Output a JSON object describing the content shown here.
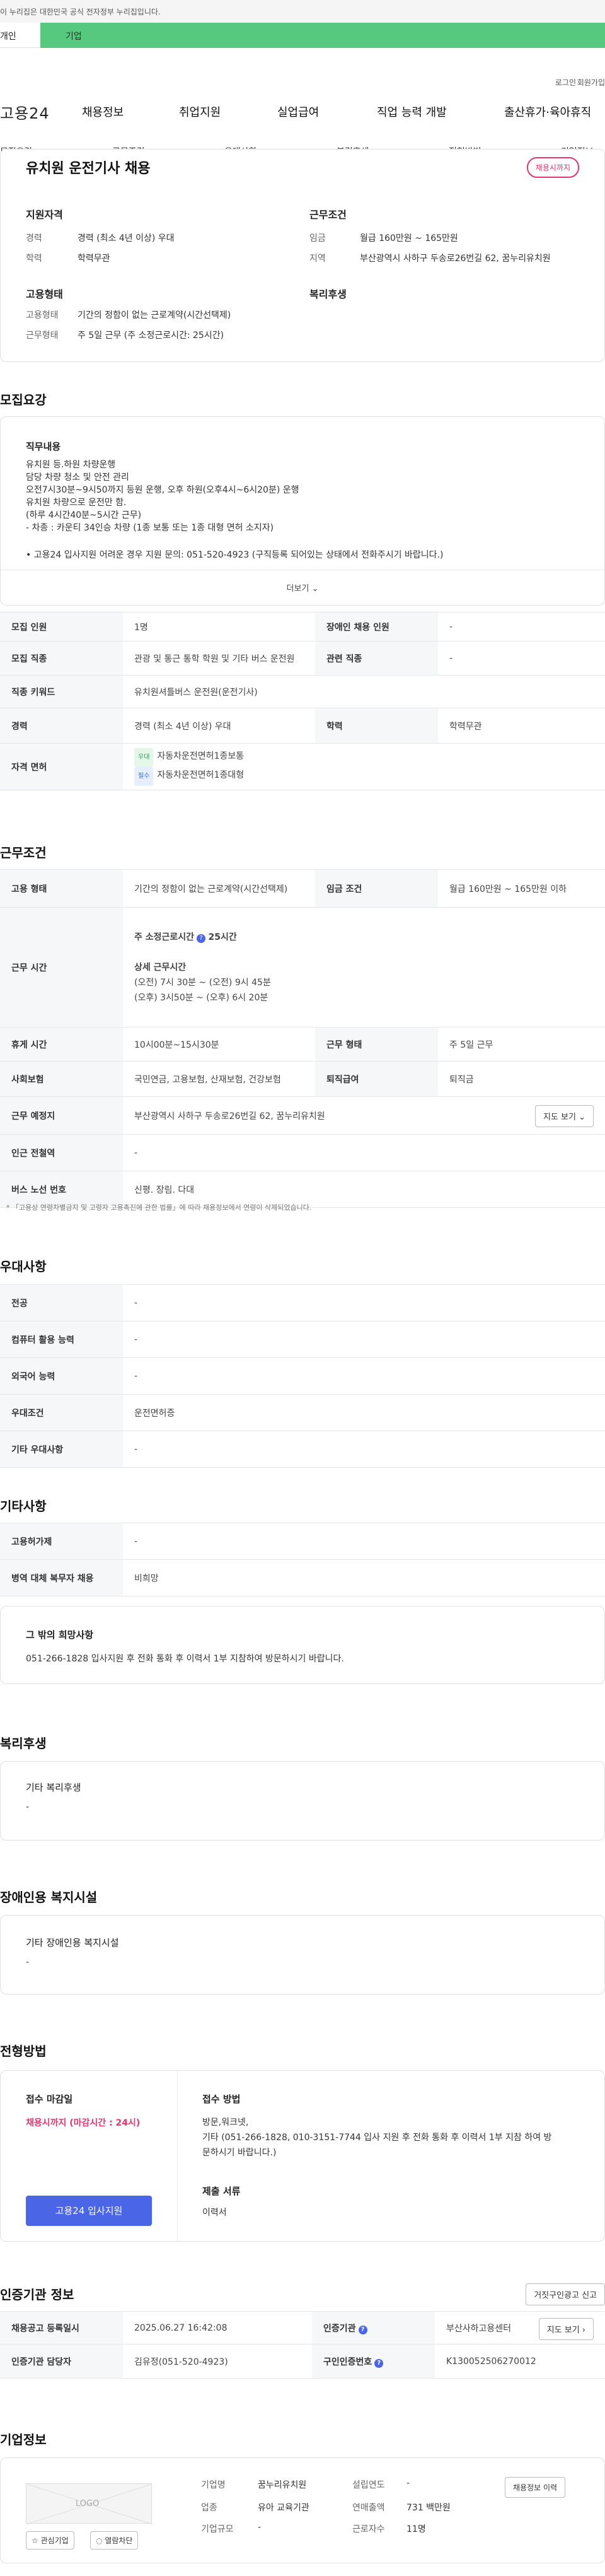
{
  "gov_banner": "이 누리집은 대한민국 공식 전자정부 누리집입니다.",
  "tabs": {
    "personal": "개인",
    "company": "기업"
  },
  "util": {
    "login": "로그인",
    "join": "회원가입"
  },
  "gnb": {
    "logo": "고용24",
    "menus": [
      "채용정보",
      "취업지원",
      "실업급여",
      "직업 능력 개발",
      "출산휴가·육아휴직"
    ]
  },
  "anchor": [
    "모집요강",
    "근무조건",
    "우대사항",
    "복리후생",
    "전형방법",
    "기업정보"
  ],
  "job_header": {
    "title": "유치원 운전기사 채용",
    "badge": "채용시까지",
    "qualification_title": "지원자격",
    "career_key": "경력",
    "career_val": "경력 (최소 4년 이상) 우대",
    "edu_key": "학력",
    "edu_val": "학력무관",
    "work_title": "근무조건",
    "wage_key": "임금",
    "wage_val": "월급 160만원 ~ 165만원",
    "region_key": "지역",
    "region_val": "부산광역시 사하구 두송로26번길 62, 꿈누리유치원",
    "employ_title": "고용형태",
    "type_key": "고용형태",
    "type_val": "기간의 정함이 없는 근로계약(시간선택제)",
    "hours_key": "근무형태",
    "hours_val": "주 5일 근무 (주 소정근로시간: 25시간)",
    "welfare_title": "복리후생"
  },
  "recruit": {
    "heading": "모집요강",
    "duty_title": "직무내용",
    "duty_lines": [
      "유치원 등.하원 차량운행",
      "담당 차량 청소 및 안전 관리",
      "오전7시30분~9시50까지 등원 운행, 오후 하원(오후4시~6시20분) 운행",
      "유치원 차량으로 운전만 함.",
      "(하루 4시간40분~5시간 근무)",
      "- 차종 : 카운티 34인승 차량 (1종 보통 또는 1종 대형 면허 소지자)"
    ],
    "duty_contact": "• 고용24 입사지원 어려운 경우 지원 문의: 051-520-4923 (구직등록 되어있는 상태에서 전화주시기 바랍니다.)",
    "more": "더보기 ⌄",
    "rows": [
      {
        "k1": "모집 인원",
        "v1": "1명",
        "k2": "장애인 채용 인원",
        "v2": "-"
      },
      {
        "k1": "모집 직종",
        "v1": "관광 및 통근 통학 학원 및 기타 버스 운전원",
        "k2": "관련 직종",
        "v2": "-"
      },
      {
        "k1": "직종 키워드",
        "v1": "유치원셔틀버스 운전원(운전기사)"
      },
      {
        "k1": "경력",
        "v1": "경력 (최소 4년 이상) 우대",
        "k2": "학력",
        "v2": "학력무관"
      }
    ],
    "license_key": "자격 면허",
    "license": [
      {
        "tag": "우대",
        "name": "자동차운전면허1종보통"
      },
      {
        "tag": "필수",
        "name": "자동차운전면허1종대형"
      }
    ]
  },
  "work": {
    "heading": "근무조건",
    "type_key": "고용 형태",
    "type_val": "기간의 정함이 없는 근로계약(시간선택제)",
    "wage_key": "임금 조건",
    "wage_val": "월급 160만원 ~ 165만원 이하",
    "time_key": "근무 시간",
    "weekly": "주 소정근로시간",
    "weekly_val": "25시간",
    "detail_title": "상세 근무시간",
    "detail_lines": [
      "(오전) 7시 30분 ~ (오전) 9시 45분",
      "(오후) 3시50분 ~ (오후) 6시 20분"
    ],
    "rows": [
      {
        "k1": "휴게 시간",
        "v1": "10시00분~15시30분",
        "k2": "근무 형태",
        "v2": "주 5일 근무"
      },
      {
        "k1": "사회보험",
        "v1": "국민연금, 고용보험, 산재보험, 건강보험",
        "k2": "퇴직급여",
        "v2": "퇴직금"
      }
    ],
    "place_key": "근무 예정지",
    "place_val": "부산광역시 사하구 두송로26번길 62, 꿈누리유치원",
    "map_btn": "지도 보기 ⌄",
    "station_key": "인근 전철역",
    "station_val": "-",
    "bus_key": "버스 노선 번호",
    "bus_val": "신평. 장림. 다대",
    "note": "* 「고용상 연령차별금지 및 고령자 고용촉진에 관한 법률」에 따라 채용정보에서 연령이 삭제되었습니다."
  },
  "prefer": {
    "heading": "우대사항",
    "rows": [
      {
        "k": "전공",
        "v": "-"
      },
      {
        "k": "컴퓨터 활용 능력",
        "v": "-"
      },
      {
        "k": "외국어 능력",
        "v": "-"
      },
      {
        "k": "우대조건",
        "v": "운전면허증"
      },
      {
        "k": "기타 우대사항",
        "v": "-"
      }
    ]
  },
  "etc": {
    "heading": "기타사항",
    "rows": [
      {
        "k": "고용허가제",
        "v": "-"
      },
      {
        "k": "병역 대체 복무자 채용",
        "v": "비희망"
      }
    ],
    "hope_title": "그 밖의 희망사항",
    "hope_text": "051-266-1828 입사지원 후 전화 통화 후 이력서 1부 지참하여 방문하시기 바랍니다."
  },
  "welfare": {
    "heading": "복리후생",
    "title": "기타 복리후생",
    "val": "-"
  },
  "disabled": {
    "heading": "장애인용 복지시설",
    "title": "기타 장애인용 복지시설",
    "val": "-"
  },
  "selection": {
    "heading": "전형방법",
    "deadline_title": "접수 마감일",
    "deadline_val": "채용시까지 (마감시간 : 24시)",
    "apply_btn": "고용24 입사지원",
    "method_title": "접수 방법",
    "method_lines": [
      "방문,워크넷,",
      "기타 (051-266-1828, 010-3151-7744 입사 지원 후 전화 통화 후 이력서 1부 지참 하여 방",
      "문하시기 바랍니다.)"
    ],
    "docs_title": "제출 서류",
    "docs_val": "이력서"
  },
  "agency": {
    "heading": "인증기관 정보",
    "report_btn": "거짓구인광고 신고",
    "r1": {
      "k1": "채용공고 등록일시",
      "v1": "2025.06.27 16:42:08",
      "k2": "인증기관",
      "v2": "부산사하고용센터",
      "btn": "지도 보기 ›"
    },
    "r2": {
      "k1": "인증기관 담당자",
      "v1": "김유정(051-520-4923)",
      "k2": "구인인증번호",
      "v2": "K130052506270012"
    }
  },
  "company": {
    "heading": "기업정보",
    "logo": "LOGO",
    "fav_btn": "☆ 관심기업",
    "block_btn": "◌ 열람차단",
    "name_k": "기업명",
    "name_v": "꿈누리유치원",
    "year_k": "설립연도",
    "year_v": "-",
    "ind_k": "업종",
    "ind_v": "유아 교육기관",
    "sales_k": "연매출액",
    "sales_v": "731 백만원",
    "size_k": "기업규모",
    "size_v": "-",
    "emp_k": "근로자수",
    "emp_v": "11명",
    "info_btn": "채용정보 이력"
  }
}
